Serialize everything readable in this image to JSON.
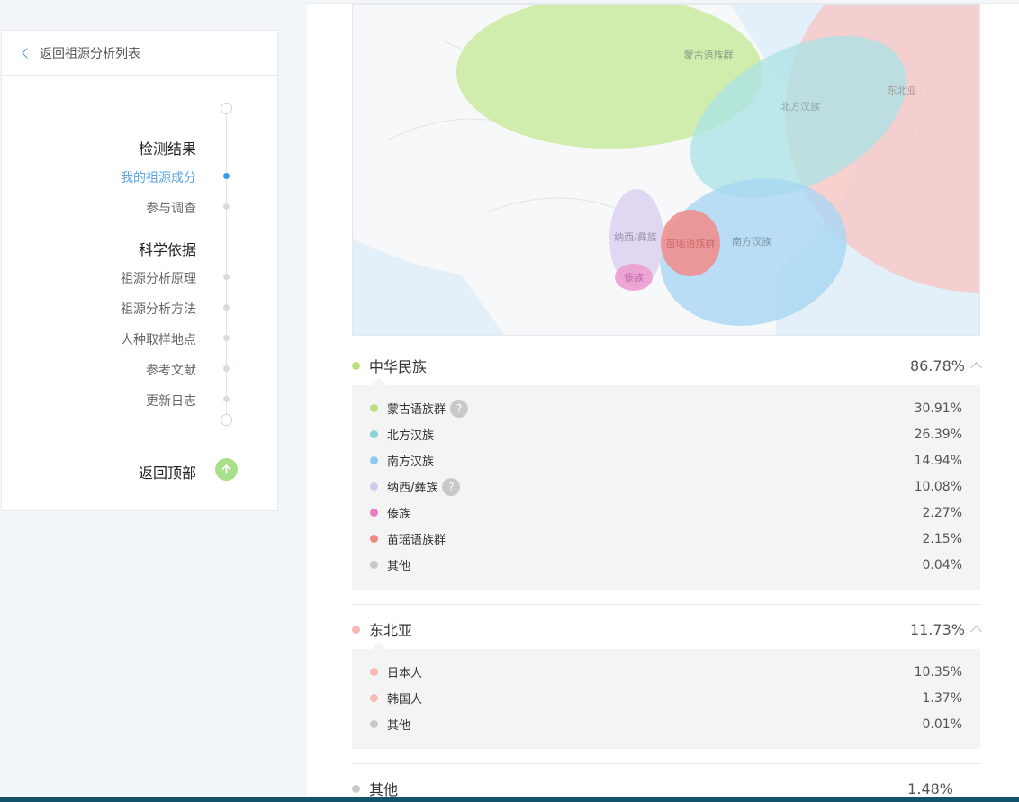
{
  "sidebar": {
    "back_label": "返回祖源分析列表",
    "sections": [
      {
        "heading": "检测结果"
      },
      {
        "heading": "科学依据"
      }
    ],
    "items": [
      {
        "label": "我的祖源成分"
      },
      {
        "label": "参与调查"
      },
      {
        "label": "祖源分析原理"
      },
      {
        "label": "祖源分析方法"
      },
      {
        "label": "人种取样地点"
      },
      {
        "label": "参考文献"
      },
      {
        "label": "更新日志"
      }
    ],
    "to_top_label": "返回顶部"
  },
  "map": {
    "regions": [
      {
        "label": "蒙古语族群",
        "color": "#c9eba1"
      },
      {
        "label": "北方汉族",
        "color": "#a9e3e6"
      },
      {
        "label": "东北亚",
        "color": "#f8c4c0"
      },
      {
        "label": "南方汉族",
        "color": "#a8d6f2"
      },
      {
        "label": "纳西/彝族",
        "color": "#ddd3f1"
      },
      {
        "label": "苗瑶语族群",
        "color": "#f08f8f"
      },
      {
        "label": "傣族",
        "color": "#ec9ed0"
      }
    ]
  },
  "groups": [
    {
      "name": "中华民族",
      "percent": "86.78%",
      "color": "#b9e07b",
      "rows": [
        {
          "name": "蒙古语族群",
          "percent": "30.91%",
          "color": "#b9e07b",
          "help": "?"
        },
        {
          "name": "北方汉族",
          "percent": "26.39%",
          "color": "#86d6d9"
        },
        {
          "name": "南方汉族",
          "percent": "14.94%",
          "color": "#8ccbef"
        },
        {
          "name": "纳西/彝族",
          "percent": "10.08%",
          "color": "#d5c8ef",
          "help": "?"
        },
        {
          "name": "傣族",
          "percent": "2.27%",
          "color": "#e87dbf"
        },
        {
          "name": "苗瑶语族群",
          "percent": "2.15%",
          "color": "#f08a87"
        },
        {
          "name": "其他",
          "percent": "0.04%",
          "color": "#c8c8c8"
        }
      ]
    },
    {
      "name": "东北亚",
      "percent": "11.73%",
      "color": "#f6b9b3",
      "rows": [
        {
          "name": "日本人",
          "percent": "10.35%",
          "color": "#f6b9b3"
        },
        {
          "name": "韩国人",
          "percent": "1.37%",
          "color": "#f6b9b3"
        },
        {
          "name": "其他",
          "percent": "0.01%",
          "color": "#c8c8c8"
        }
      ]
    },
    {
      "name": "其他",
      "percent": "1.48%",
      "color": "#c8c8c8"
    }
  ]
}
